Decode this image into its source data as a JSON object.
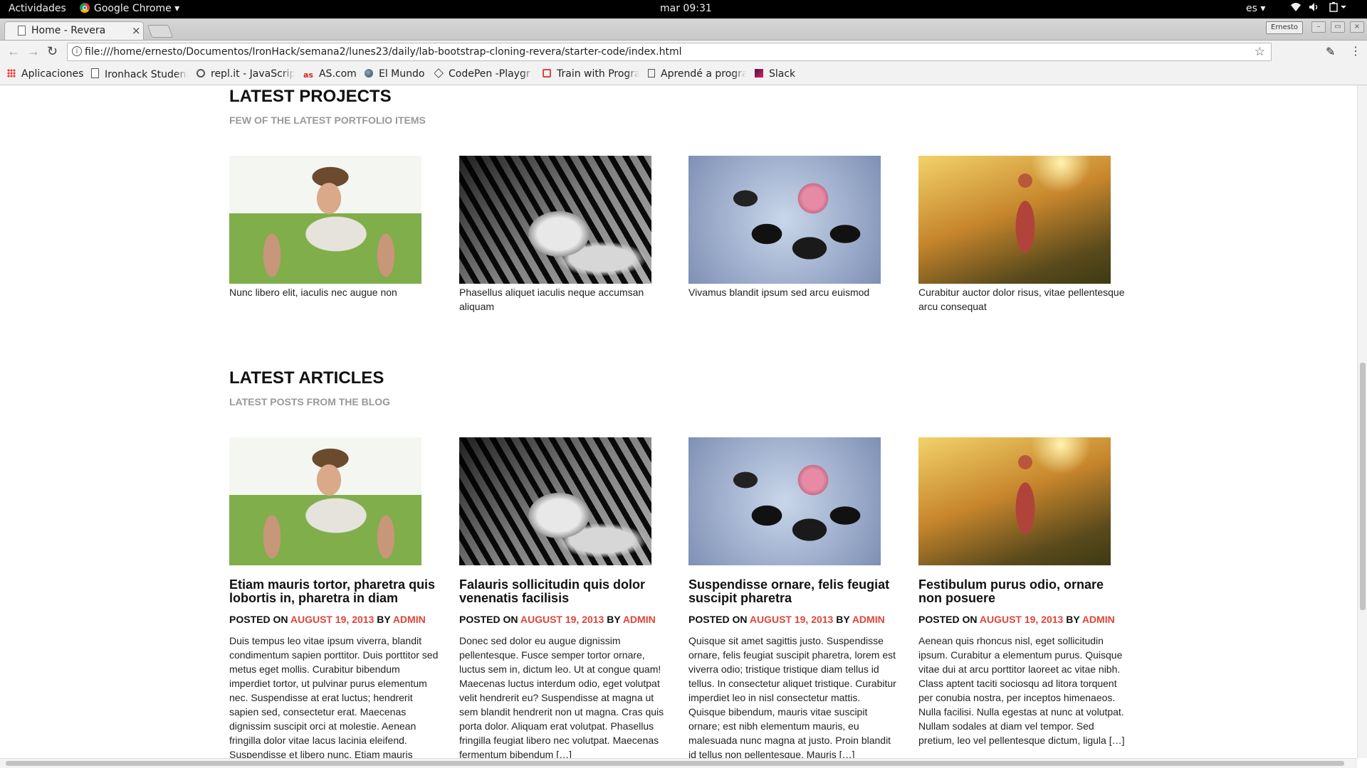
{
  "os_bar": {
    "activities": "Actividades",
    "app_name": "Google Chrome ▾",
    "clock": "mar 09:31",
    "language": "es ▾"
  },
  "browser": {
    "tab_title": "Home - Revera",
    "tab_close": "×",
    "profile_name": "Ernesto",
    "url": "file:///home/ernesto/Documentos/IronHack/semana2/lunes23/daily/lab-bootstrap-cloning-revera/starter-code/index.html",
    "bookmarks": [
      {
        "label": "Aplicaciones",
        "icon": "apps-grid-icon"
      },
      {
        "label": "Ironhack Student",
        "icon": "page-icon"
      },
      {
        "label": "repl.it - JavaScrip",
        "icon": "replit-icon"
      },
      {
        "label": "AS.com",
        "icon": "as-icon"
      },
      {
        "label": "El Mundo",
        "icon": "globe-icon"
      },
      {
        "label": "CodePen -Playgr",
        "icon": "codepen-icon"
      },
      {
        "label": "Train with Progra",
        "icon": "train-icon"
      },
      {
        "label": "Aprendé a progra",
        "icon": "book-icon"
      },
      {
        "label": "Slack",
        "icon": "slack-icon"
      }
    ]
  },
  "projects": {
    "title": "LATEST PROJECTS",
    "subtitle": "FEW OF THE LATEST PORTFOLIO ITEMS",
    "items": [
      {
        "caption": "Nunc libero elit, iaculis nec augue non"
      },
      {
        "caption": "Phasellus aliquet iaculis neque accumsan aliquam"
      },
      {
        "caption": "Vivamus blandit ipsum sed arcu euismod"
      },
      {
        "caption": "Curabitur auctor dolor risus, vitae pellentesque arcu consequat"
      }
    ]
  },
  "articles": {
    "title": "LATEST ARTICLES",
    "subtitle": "LATEST POSTS FROM THE BLOG",
    "posted_on_label": "POSTED ON",
    "by_label": "BY",
    "items": [
      {
        "title": "Etiam mauris tortor, pharetra quis lobortis in, pharetra in diam",
        "date": "AUGUST 19, 2013",
        "author": "ADMIN",
        "excerpt": "Duis tempus leo vitae ipsum viverra, blandit condimentum sapien porttitor. Duis porttitor sed metus eget mollis. Curabitur bibendum imperdiet tortor, ut pulvinar purus elementum nec. Suspendisse at erat luctus; hendrerit sapien sed, consectetur erat. Maecenas dignissim suscipit orci at molestie. Aenean fringilla dolor vitae lacus lacinia eleifend. Suspendisse et libero nunc. Etiam mauris"
      },
      {
        "title": "Falauris sollicitudin quis dolor venenatis facilisis",
        "date": "AUGUST 19, 2013",
        "author": "ADMIN",
        "excerpt": "Donec sed dolor eu augue dignissim pellentesque. Fusce semper tortor ornare, luctus sem in, dictum leo. Ut at congue quam! Maecenas luctus interdum odio, eget volutpat velit hendrerit eu? Suspendisse at magna ut sem blandit hendrerit non ut magna. Cras quis porta dolor. Aliquam erat volutpat. Phasellus fringilla feugiat libero nec volutpat. Maecenas fermentum bibendum […]"
      },
      {
        "title": "Suspendisse ornare, felis feugiat suscipit pharetra",
        "date": "AUGUST 19, 2013",
        "author": "ADMIN",
        "excerpt": "Quisque sit amet sagittis justo. Suspendisse ornare, felis feugiat suscipit pharetra, lorem est viverra odio; tristique tristique diam tellus id tellus. In consectetur aliquet tristique. Curabitur imperdiet leo in nisl consectetur mattis. Quisque bibendum, mauris vitae suscipit ornare; est nibh elementum mauris, eu malesuada nunc magna at justo. Proin blandit id tellus non pellentesque. Mauris […]"
      },
      {
        "title": "Festibulum purus odio, ornare non posuere",
        "date": "AUGUST 19, 2013",
        "author": "ADMIN",
        "excerpt": "Aenean quis rhoncus nisl, eget sollicitudin ipsum. Curabitur a elementum purus. Quisque vitae dui at arcu porttitor laoreet ac vitae nibh. Class aptent taciti sociosqu ad litora torquent per conubia nostra, per inceptos himenaeos. Nulla facilisi. Nulla egestas at nunc at volutpat. Nullam sodales at diam vel tempor. Sed pretium, leo vel pellentesque dictum, ligula […]"
      }
    ]
  },
  "colors": {
    "accent": "#e0453a",
    "subtitle_gray": "#999999"
  }
}
